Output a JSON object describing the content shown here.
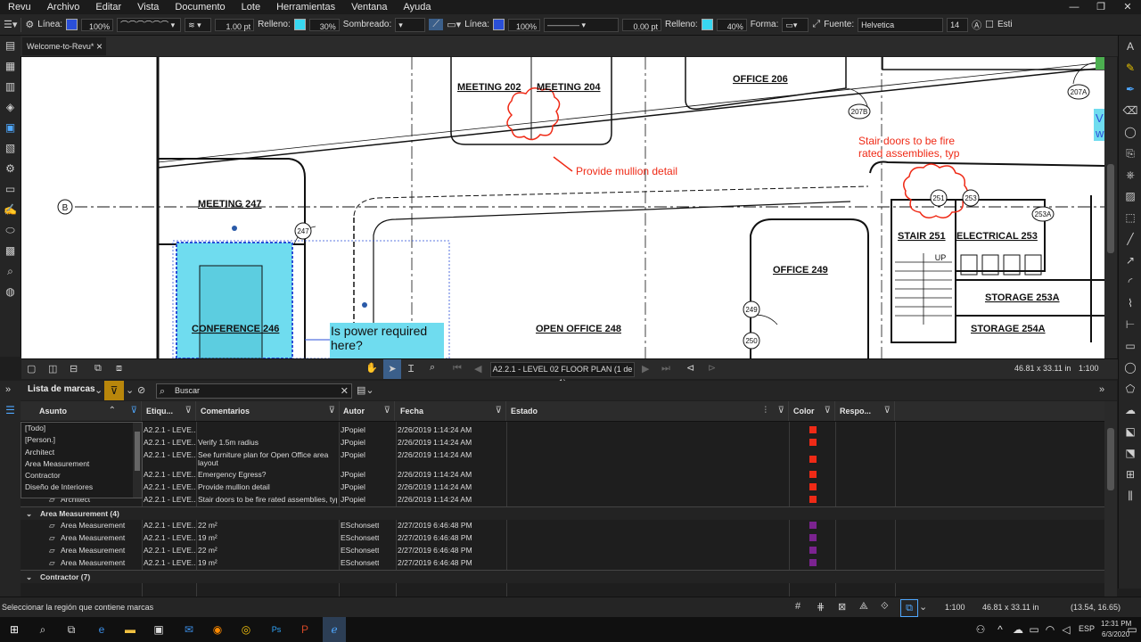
{
  "menu": [
    "Revu",
    "Archivo",
    "Editar",
    "Vista",
    "Documento",
    "Lote",
    "Herramientas",
    "Ventana",
    "Ayuda"
  ],
  "window_controls": [
    "—",
    "❐",
    "✕"
  ],
  "props": {
    "linea_label": "Línea:",
    "opacity1": "100%",
    "stroke_width": "1.00 pt",
    "relleno_label": "Relleno:",
    "fill_opacity": "30%",
    "sombreado_label": "Sombreado:",
    "linea2_label": "Línea:",
    "opacity2": "100%",
    "offset": "0.00 pt",
    "relleno2_label": "Relleno:",
    "fill_opacity2": "40%",
    "forma_label": "Forma:",
    "fuente_label": "Fuente:",
    "font_name": "Helvetica",
    "font_size": "14",
    "style_label": "Esti"
  },
  "colors": {
    "stroke": "#2a4fd8",
    "fill": "#38d7f0",
    "markup_red": "#ef2a16",
    "markup_purple": "#7b2390",
    "filter_active": "#b8860b"
  },
  "tab": {
    "title": "Welcome-to-Revu*"
  },
  "drawing": {
    "rooms": [
      "MEETING  202",
      "MEETING  204",
      "OFFICE  206",
      "MEETING  247",
      "CONFERENCE  246",
      "OPEN OFFICE  248",
      "OFFICE  249",
      "STAIR  251",
      "ELECTRICAL  253",
      "STORAGE  253A",
      "STORAGE  254A"
    ],
    "tags": [
      "247",
      "249",
      "250",
      "251",
      "253",
      "253A",
      "207B",
      "207A",
      "B",
      "UP"
    ],
    "notes": [
      "Provide mullion detail",
      "Stair doors to be fire",
      "rated assemblies, typ"
    ],
    "callout": [
      "Is power required",
      "here?"
    ],
    "edge_text": [
      "V",
      "w"
    ]
  },
  "navbar": {
    "page": "A2.2.1 - LEVEL 02 FLOOR PLAN (1 de 1)",
    "dims": "46.81 x 33.11 in",
    "scale": "1:100"
  },
  "markup_list": {
    "title": "Lista de marcas",
    "search_placeholder": "Buscar",
    "columns": [
      "Asunto",
      "Etiqu...",
      "Comentarios",
      "Autor",
      "Fecha",
      "Estado",
      "Color",
      "Respo..."
    ],
    "filter_options": [
      "[Todo]",
      "[Person.]",
      "Architect",
      "Area Measurement",
      "Contractor",
      "Diseño de Interiores"
    ],
    "rows": [
      {
        "type": "item",
        "subject": "",
        "label": "A2.2.1 - LEVE...",
        "comment": "",
        "author": "JPopiel",
        "date": "2/26/2019 1:14:24 AM",
        "color": "red"
      },
      {
        "type": "item",
        "subject": "",
        "label": "A2.2.1 - LEVE...",
        "comment": "Verify 1.5m radius",
        "author": "JPopiel",
        "date": "2/26/2019 1:14:24 AM",
        "color": "red"
      },
      {
        "type": "item",
        "subject": "",
        "label": "A2.2.1 - LEVE...",
        "comment": "See furniture plan for Open Office area",
        "comment2": "layout",
        "author": "JPopiel",
        "date": "2/26/2019 1:14:24 AM",
        "color": "red"
      },
      {
        "type": "item",
        "subject": "",
        "label": "A2.2.1 - LEVE...",
        "comment": "Emergency Egress?",
        "author": "JPopiel",
        "date": "2/26/2019 1:14:24 AM",
        "color": "red"
      },
      {
        "type": "item",
        "subject": "Architect",
        "label": "A2.2.1 - LEVE...",
        "comment": "Provide mullion detail",
        "author": "JPopiel",
        "date": "2/26/2019 1:14:24 AM",
        "color": "red"
      },
      {
        "type": "item",
        "subject": "Architect",
        "label": "A2.2.1 - LEVE...",
        "comment": "Stair doors to be fire rated assemblies, typ",
        "author": "JPopiel",
        "date": "2/26/2019 1:14:24 AM",
        "color": "red"
      },
      {
        "type": "group",
        "subject": "Area Measurement (4)"
      },
      {
        "type": "item",
        "subject": "Area Measurement",
        "label": "A2.2.1 - LEVE...",
        "comment": "22 m²",
        "author": "ESchonsett",
        "date": "2/27/2019 6:46:48 PM",
        "color": "purple"
      },
      {
        "type": "item",
        "subject": "Area Measurement",
        "label": "A2.2.1 - LEVE...",
        "comment": "19 m²",
        "author": "ESchonsett",
        "date": "2/27/2019 6:46:48 PM",
        "color": "purple"
      },
      {
        "type": "item",
        "subject": "Area Measurement",
        "label": "A2.2.1 - LEVE...",
        "comment": "22 m²",
        "author": "ESchonsett",
        "date": "2/27/2019 6:46:48 PM",
        "color": "purple"
      },
      {
        "type": "item",
        "subject": "Area Measurement",
        "label": "A2.2.1 - LEVE...",
        "comment": "19 m²",
        "author": "ESchonsett",
        "date": "2/27/2019 6:46:48 PM",
        "color": "purple"
      },
      {
        "type": "group",
        "subject": "Contractor (7)"
      }
    ]
  },
  "status": {
    "message": "Seleccionar la región que contiene marcas",
    "scale": "1:100",
    "dims": "46.81 x 33.11 in",
    "coords": "(13.54, 16.65)"
  },
  "taskbar": {
    "lang": "ESP",
    "time": "12:31 PM",
    "date": "6/3/2020"
  }
}
